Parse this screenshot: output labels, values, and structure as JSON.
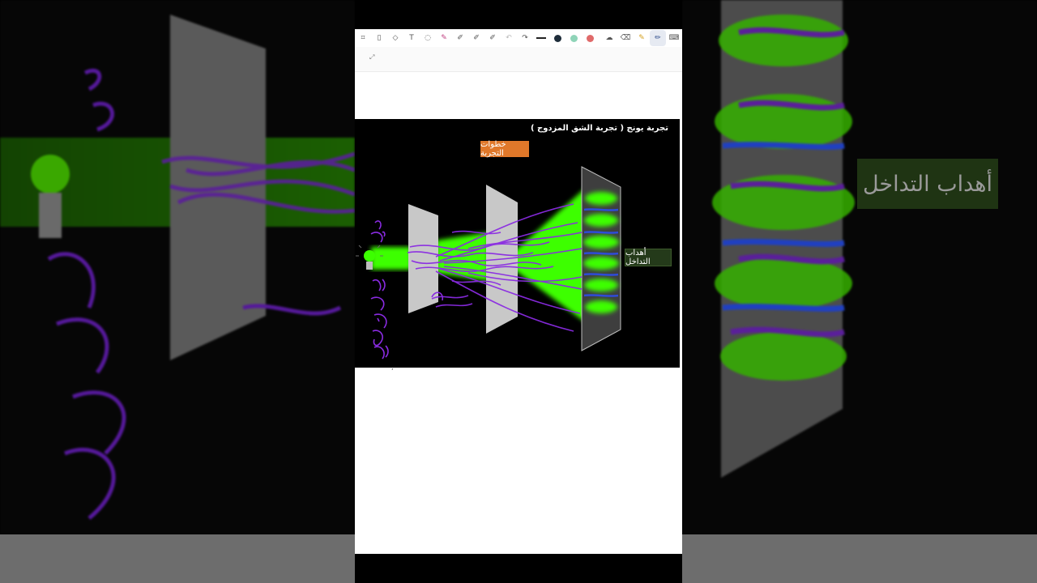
{
  "slide": {
    "title": "تجربة يونج ( تجربة الشق المزدوج )",
    "steps_button": "خطوات التجربة",
    "interference_label": "أهداب التداخل"
  },
  "backdrop": {
    "label": "أهداب التداخل"
  },
  "toolbar": {
    "icons": [
      "layout-icon",
      "page-icon",
      "shapes-icon",
      "text-icon",
      "lasso-icon",
      "pen-icon",
      "pen-outline-icon",
      "pen-outline-icon-2",
      "pen-outline-icon-3",
      "undo-icon",
      "redo-icon",
      "line-width-icon",
      "color-dark",
      "color-mint",
      "color-red",
      "cloud-icon",
      "eraser-icon",
      "highlighter-icon",
      "pencil-icon",
      "keyboard-icon"
    ],
    "colors": {
      "dark": "#1e2d3a",
      "mint": "#8fd4b8",
      "red": "#e06a6a"
    }
  },
  "colors": {
    "beam": "#3cff00",
    "scribble": "#8a2be2",
    "fringe_blue": "#2f4bd8"
  }
}
